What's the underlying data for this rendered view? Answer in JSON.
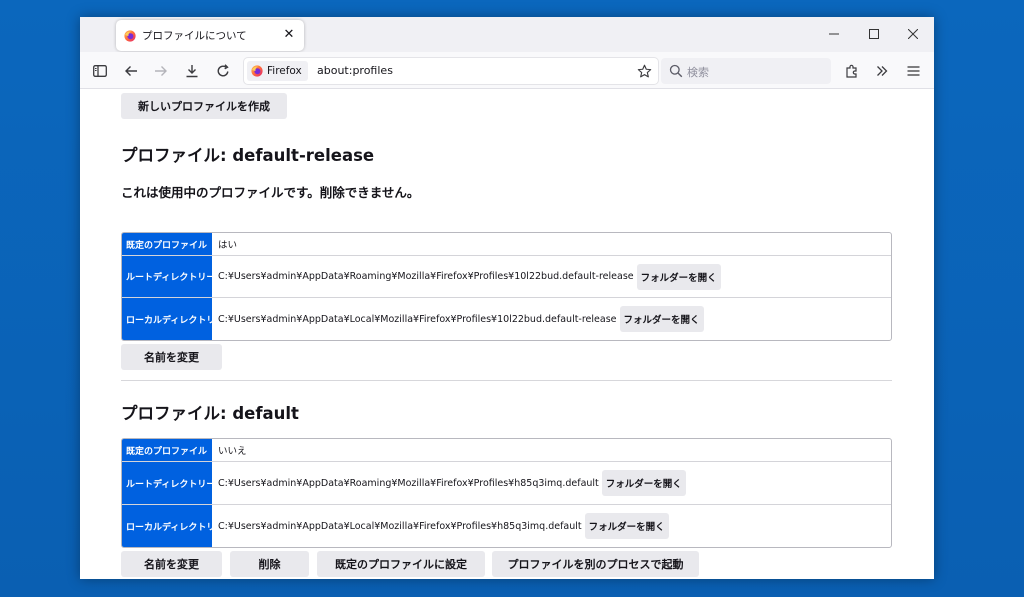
{
  "tab": {
    "title": "プロファイルについて",
    "close": "✕"
  },
  "window_controls": {
    "minimize": "—",
    "maximize": "☐",
    "close": "✕"
  },
  "urlbar": {
    "identity": "Firefox",
    "url": "about:profiles"
  },
  "searchbar": {
    "placeholder": "検索"
  },
  "colors": {
    "accent": "#0061e0",
    "desktop": "#0a63b8"
  },
  "page": {
    "create_button": "新しいプロファイルを作成",
    "profiles": [
      {
        "heading": "プロファイル: default-release",
        "note": "これは使用中のプロファイルです。削除できません。",
        "rows": {
          "default": {
            "key": "既定のプロファイル",
            "value": "はい"
          },
          "root": {
            "key": "ルートディレクトリー",
            "value": "C:¥Users¥admin¥AppData¥Roaming¥Mozilla¥Firefox¥Profiles¥10l22bud.default-release",
            "button": "フォルダーを開く"
          },
          "local": {
            "key": "ローカルディレクトリー",
            "value": "C:¥Users¥admin¥AppData¥Local¥Mozilla¥Firefox¥Profiles¥10l22bud.default-release",
            "button": "フォルダーを開く"
          }
        },
        "buttons": {
          "rename": "名前を変更"
        }
      },
      {
        "heading": "プロファイル: default",
        "rows": {
          "default": {
            "key": "既定のプロファイル",
            "value": "いいえ"
          },
          "root": {
            "key": "ルートディレクトリー",
            "value": "C:¥Users¥admin¥AppData¥Roaming¥Mozilla¥Firefox¥Profiles¥h85q3imq.default",
            "button": "フォルダーを開く"
          },
          "local": {
            "key": "ローカルディレクトリー",
            "value": "C:¥Users¥admin¥AppData¥Local¥Mozilla¥Firefox¥Profiles¥h85q3imq.default",
            "button": "フォルダーを開く"
          }
        },
        "buttons": {
          "rename": "名前を変更",
          "remove": "削除",
          "set_default": "既定のプロファイルに設定",
          "launch": "プロファイルを別のプロセスで起動"
        }
      }
    ]
  }
}
